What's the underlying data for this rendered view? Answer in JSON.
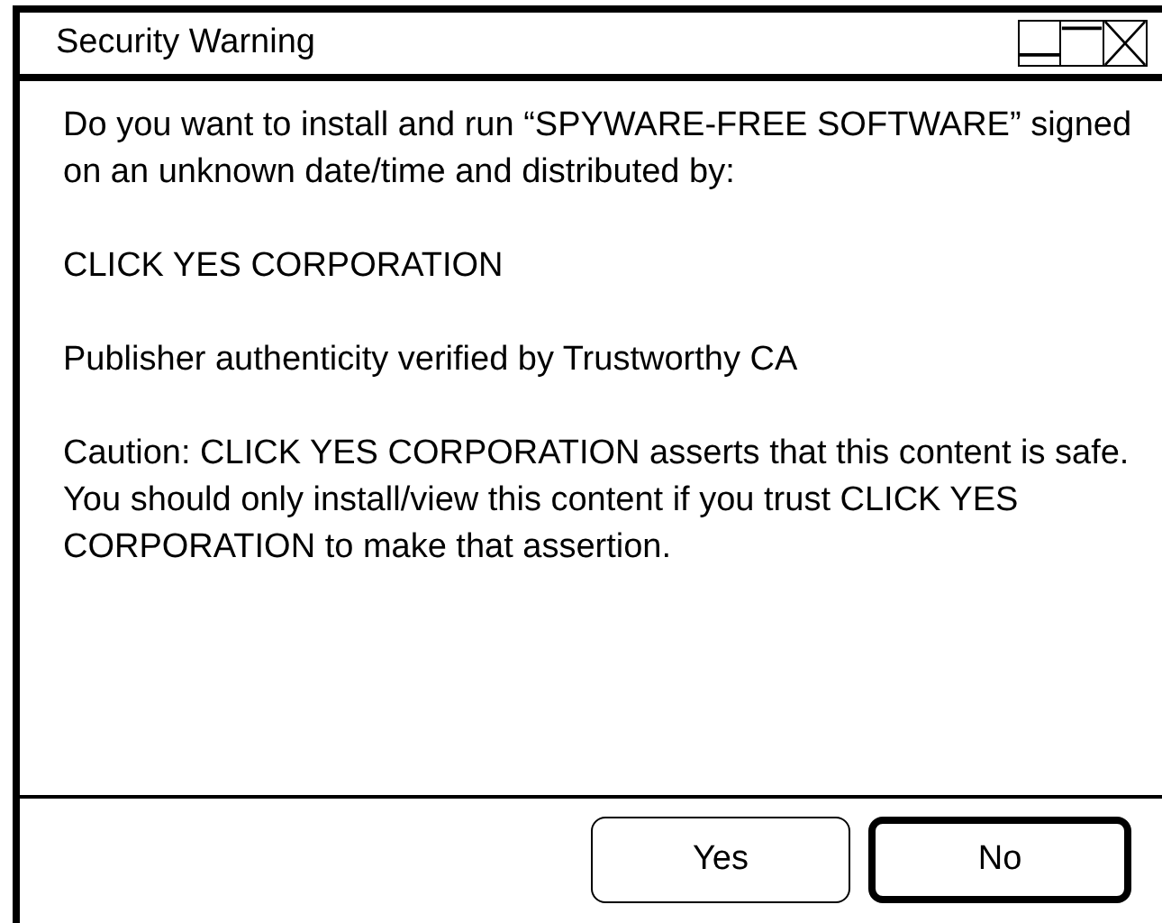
{
  "window": {
    "title": "Security Warning"
  },
  "paragraphs": [
    "Do you want to install and run “SPYWARE-FREE SOFTWARE” signed on an unknown date/time and distributed by:",
    "CLICK YES CORPORATION",
    "Publisher authenticity verified by Trustworthy CA",
    "Caution: CLICK YES CORPORATION asserts that this content is safe. You should only install/view this content if you trust CLICK YES CORPORATION to make that assertion."
  ],
  "buttons": [
    {
      "label": "Yes",
      "default": false
    },
    {
      "label": "No",
      "default": true
    }
  ]
}
